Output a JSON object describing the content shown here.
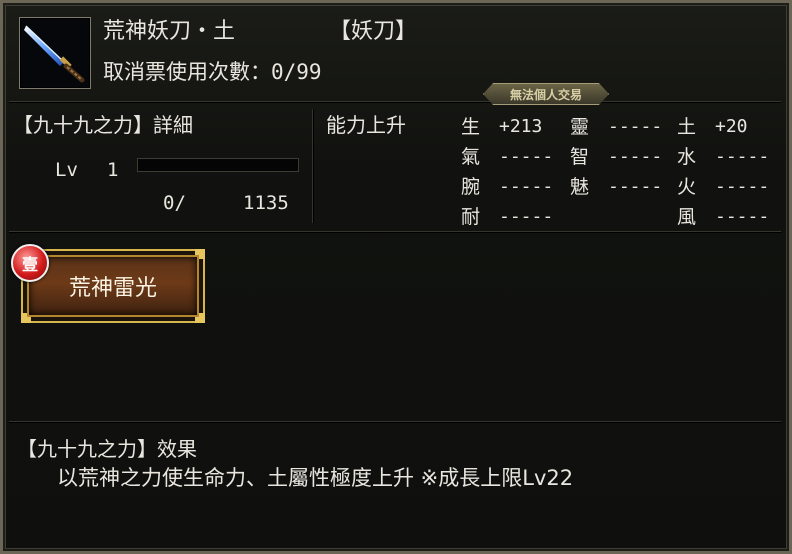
{
  "item": {
    "name": "荒神妖刀・土",
    "category": "【妖刀】",
    "uses_label": "取消票使用次數：",
    "uses_value": "0/99",
    "icon": "sword-icon"
  },
  "trade_badge": "無法個人交易",
  "detail": {
    "title": "【九十九之力】詳細",
    "lv_label": "Lv",
    "lv_value": "1",
    "exp_current": "0/",
    "exp_max": "1135",
    "exp_fraction": 0
  },
  "abilities": {
    "title": "能力上升",
    "col1": [
      {
        "name": "生",
        "value": "+213"
      },
      {
        "name": "氣",
        "value": "-----"
      },
      {
        "name": "腕",
        "value": "-----"
      },
      {
        "name": "耐",
        "value": "-----"
      }
    ],
    "col2": [
      {
        "name": "靈",
        "value": "-----"
      },
      {
        "name": "智",
        "value": "-----"
      },
      {
        "name": "魅",
        "value": "-----"
      }
    ],
    "col3": [
      {
        "name": "土",
        "value": "+20"
      },
      {
        "name": "水",
        "value": "-----"
      },
      {
        "name": "火",
        "value": "-----"
      },
      {
        "name": "風",
        "value": "-----"
      }
    ]
  },
  "skill": {
    "rank": "壹",
    "name": "荒神雷光"
  },
  "effect": {
    "title": "【九十九之力】效果",
    "text": "以荒神之力使生命力、土屬性極度上升 ※成長上限Lv22"
  },
  "colors": {
    "gold": "#d7b74d",
    "badge_red": "#d31b1b"
  }
}
